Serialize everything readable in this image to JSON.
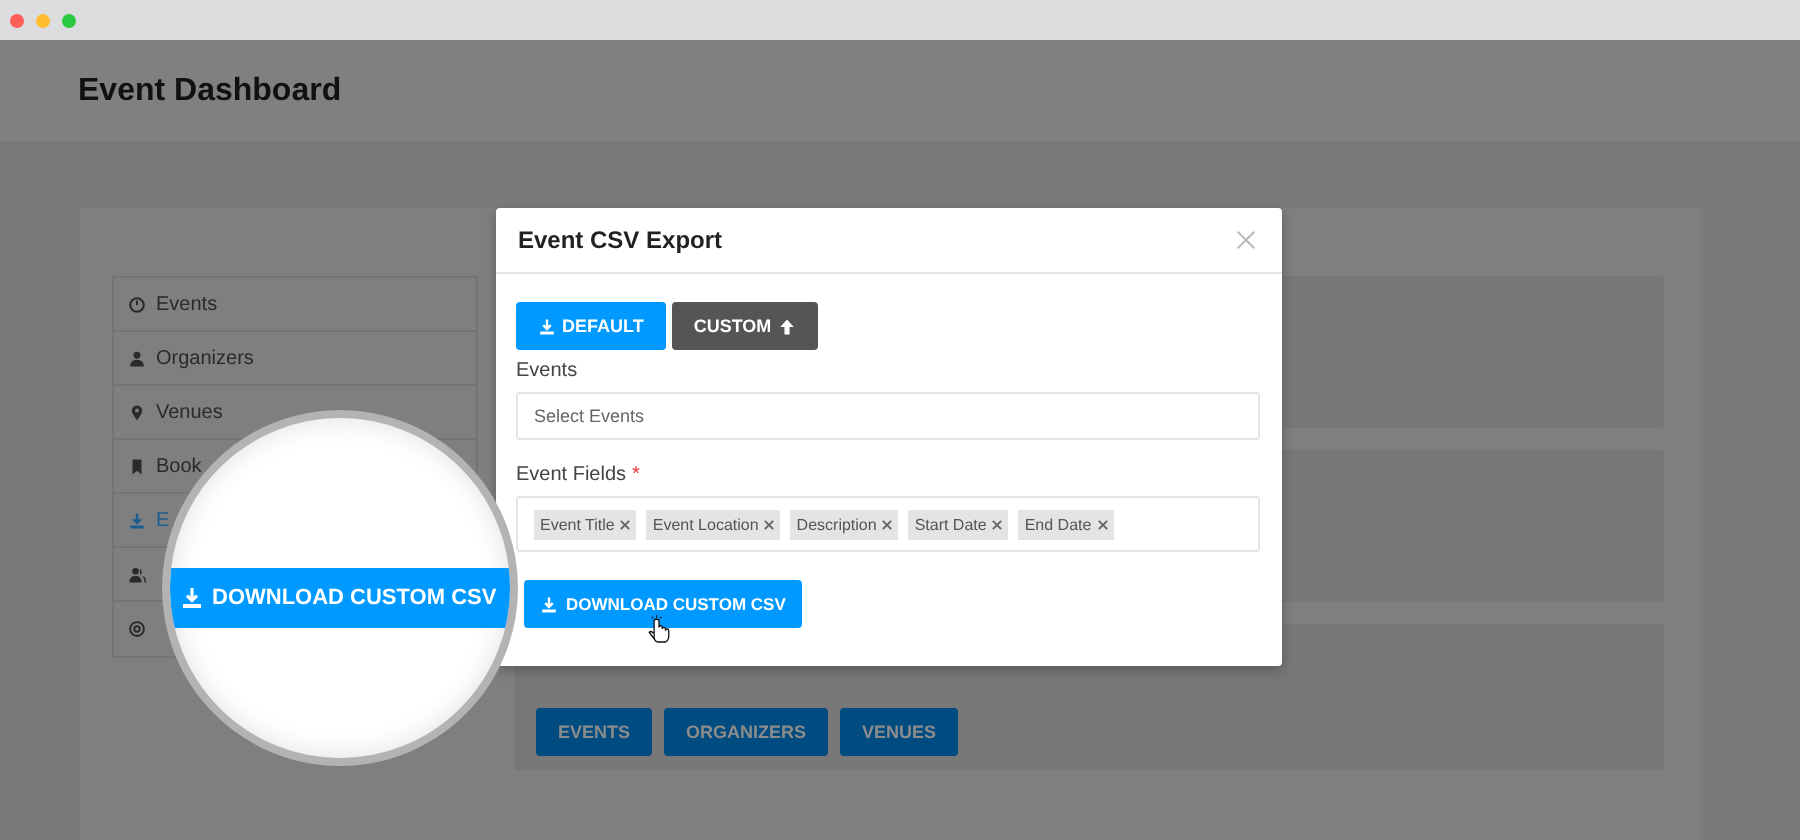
{
  "header": {
    "title": "Event Dashboard"
  },
  "sidebar": {
    "items": [
      {
        "label": "Events",
        "kind": "gauge",
        "selected": false
      },
      {
        "label": "Organizers",
        "kind": "user",
        "selected": false
      },
      {
        "label": "Venues",
        "kind": "pin",
        "selected": false
      },
      {
        "label": "Book",
        "kind": "bookmark",
        "selected": false
      },
      {
        "label": "E",
        "kind": "download",
        "selected": true
      },
      {
        "kind": "users",
        "selected": false
      },
      {
        "kind": "at",
        "selected": false
      }
    ]
  },
  "panel_buttons": [
    "EVENTS",
    "ORGANIZERS",
    "VENUES"
  ],
  "modal": {
    "title": "Event CSV Export",
    "modes": [
      {
        "label": "DEFAULT",
        "kind": "download",
        "selected": true
      },
      {
        "label": "CUSTOM",
        "kind": "upload",
        "selected": false
      }
    ],
    "events_label": "Events",
    "events_placeholder": "Select Events",
    "fields_label": "Event Fields",
    "fields_required": "*",
    "fields": [
      "Event Title",
      "Event Location",
      "Description",
      "Start Date",
      "End Date"
    ],
    "download_button": "DOWNLOAD CUSTOM CSV"
  },
  "magnifier": {
    "button": "DOWNLOAD CUSTOM CSV"
  }
}
